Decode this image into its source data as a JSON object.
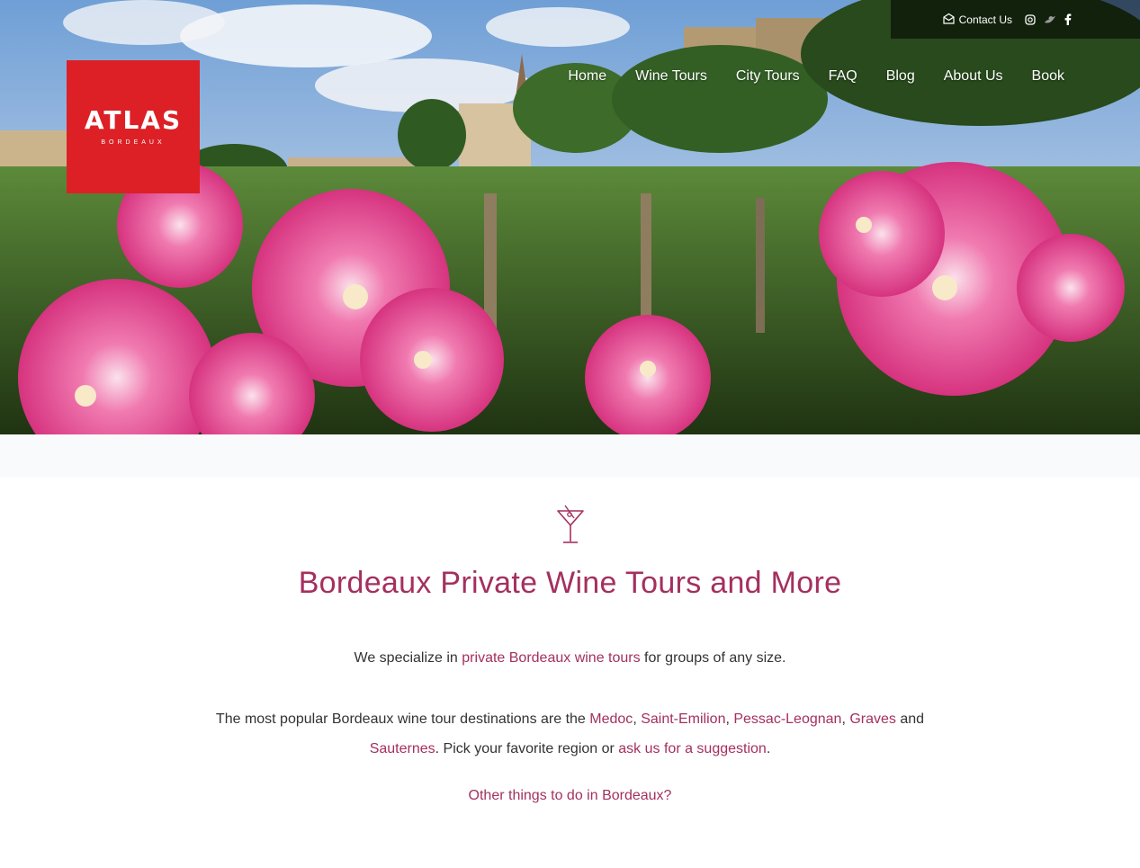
{
  "topbar": {
    "contact_label": "Contact Us",
    "icons": [
      "envelope-icon",
      "instagram-icon",
      "twitter-icon",
      "facebook-icon"
    ]
  },
  "logo": {
    "brand": "ATLAS",
    "subtitle": "BORDEAUX",
    "color": "#dc2026"
  },
  "nav": {
    "items": [
      {
        "label": "Home"
      },
      {
        "label": "Wine Tours"
      },
      {
        "label": "City Tours"
      },
      {
        "label": "FAQ"
      },
      {
        "label": "Blog"
      },
      {
        "label": "About Us"
      },
      {
        "label": "Book"
      }
    ]
  },
  "main": {
    "icon": "martini-glass-icon",
    "title": "Bordeaux Private Wine Tours and More",
    "p1": {
      "before": "We specialize in ",
      "link": "private Bordeaux wine tours",
      "after": " for groups of any size."
    },
    "p2": {
      "before": "The most popular Bordeaux wine tour destinations are the ",
      "link_medoc": "Medoc",
      "sep1": ", ",
      "link_saint_emilion": "Saint-Emilion",
      "sep2": ", ",
      "link_pessac": "Pessac-Leognan",
      "sep3": ", ",
      "link_graves": "Graves",
      "and": " and ",
      "link_sauternes": "Sauternes",
      "middle": ". Pick your favorite region or ",
      "link_suggestion": "ask us for a suggestion",
      "end": "."
    },
    "p3_link": "Other things to do in Bordeaux?"
  },
  "colors": {
    "accent": "#a4305f",
    "text": "#333333",
    "band": "#f9fafc"
  }
}
